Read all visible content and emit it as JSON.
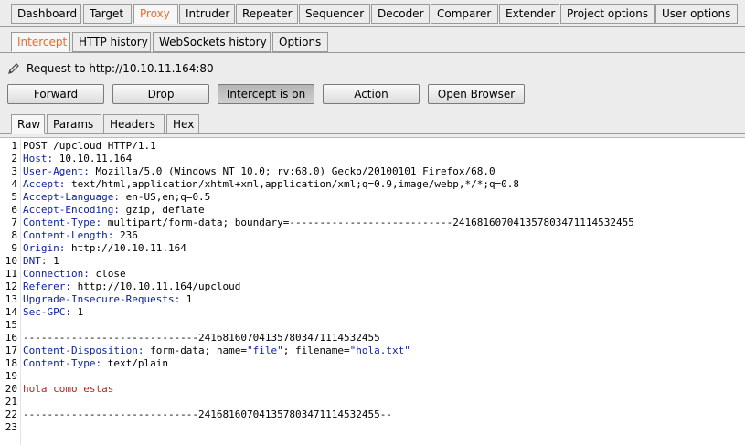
{
  "top_tabs": [
    "Dashboard",
    "Target",
    "Proxy",
    "Intruder",
    "Repeater",
    "Sequencer",
    "Decoder",
    "Comparer",
    "Extender",
    "Project options",
    "User options"
  ],
  "sub_tabs": [
    "Intercept",
    "HTTP history",
    "WebSockets history",
    "Options"
  ],
  "request_label": "Request to http://10.10.11.164:80",
  "buttons": {
    "forward": "Forward",
    "drop": "Drop",
    "intercept": "Intercept is on",
    "action": "Action",
    "open_browser": "Open Browser"
  },
  "message_tabs": [
    "Raw",
    "Params",
    "Headers",
    "Hex"
  ],
  "editor": {
    "line_numbers": [
      "1",
      "2",
      "3",
      "4",
      "5",
      "6",
      "7",
      "8",
      "9",
      "10",
      "11",
      "12",
      "13",
      "14",
      "15",
      "16",
      "17",
      "18",
      "19",
      "20",
      "21",
      "22",
      "23"
    ],
    "lines": [
      {
        "key": "",
        "value": "POST /upcloud HTTP/1.1"
      },
      {
        "key": "Host:",
        "value": " 10.10.11.164"
      },
      {
        "key": "User-Agent:",
        "value": " Mozilla/5.0 (Windows NT 10.0; rv:68.0) Gecko/20100101 Firefox/68.0"
      },
      {
        "key": "Accept:",
        "value": " text/html,application/xhtml+xml,application/xml;q=0.9,image/webp,*/*;q=0.8"
      },
      {
        "key": "Accept-Language:",
        "value": " en-US,en;q=0.5"
      },
      {
        "key": "Accept-Encoding:",
        "value": " gzip, deflate"
      },
      {
        "key": "Content-Type:",
        "value": " multipart/form-data; boundary=---------------------------241681607041357803471114532455"
      },
      {
        "key": "Content-Length:",
        "value": " 236"
      },
      {
        "key": "Origin:",
        "value": " http://10.10.11.164"
      },
      {
        "key": "DNT:",
        "value": " 1"
      },
      {
        "key": "Connection:",
        "value": " close"
      },
      {
        "key": "Referer:",
        "value": " http://10.10.11.164/upcloud"
      },
      {
        "key": "Upgrade-Insecure-Requests:",
        "value": " 1"
      },
      {
        "key": "Sec-GPC:",
        "value": " 1"
      },
      {
        "key": "",
        "value": ""
      },
      {
        "key": "",
        "value": "-----------------------------241681607041357803471114532455"
      },
      {
        "key": "Content-Disposition:",
        "value": " form-data; name=",
        "str1": "\"file\"",
        "mid": "; filename=",
        "str2": "\"hola.txt\""
      },
      {
        "key": "Content-Type:",
        "value": " text/plain"
      },
      {
        "key": "",
        "value": ""
      },
      {
        "key": "",
        "value": "hola como estas",
        "body": true
      },
      {
        "key": "",
        "value": ""
      },
      {
        "key": "",
        "value": "-----------------------------241681607041357803471114532455--"
      },
      {
        "key": "",
        "value": ""
      }
    ]
  },
  "colors": {
    "accent": "#ef6a2a",
    "header_key": "#0a1fa8",
    "body_text": "#b42828",
    "editor_bg": "#ffffff",
    "chrome_bg": "#ececec"
  }
}
